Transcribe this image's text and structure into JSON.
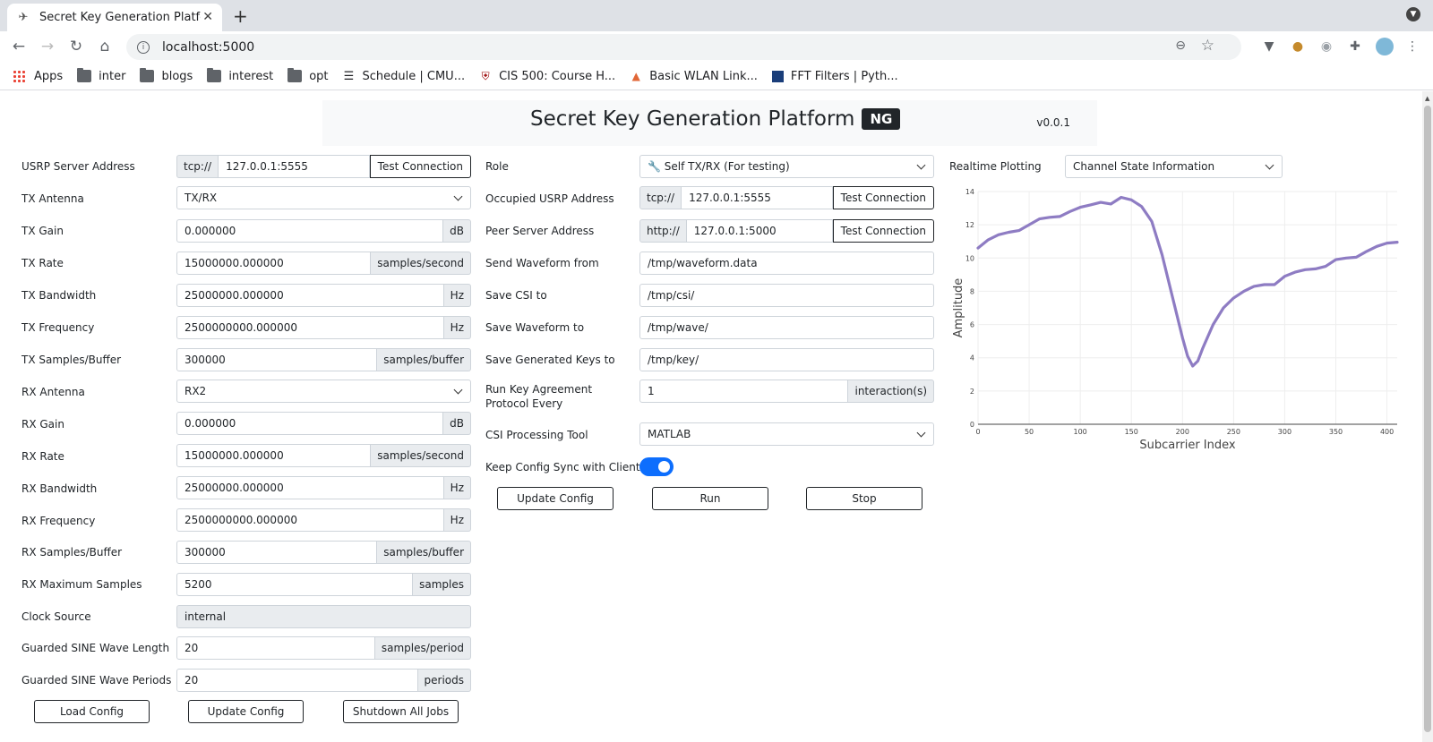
{
  "browser": {
    "tab_title": "Secret Key Generation Platfor",
    "url": "localhost:5000",
    "bookmarks": [
      {
        "label": "Apps",
        "icon": "apps-icon"
      },
      {
        "label": "inter",
        "icon": "folder-icon"
      },
      {
        "label": "blogs",
        "icon": "folder-icon"
      },
      {
        "label": "interest",
        "icon": "folder-icon"
      },
      {
        "label": "opt",
        "icon": "folder-icon"
      },
      {
        "label": "Schedule | CMU...",
        "icon": "database-icon"
      },
      {
        "label": "CIS 500: Course H...",
        "icon": "penn-shield-icon"
      },
      {
        "label": "Basic WLAN Link...",
        "icon": "matlab-icon"
      },
      {
        "label": "FFT Filters | Pyth...",
        "icon": "chart-icon"
      }
    ]
  },
  "header": {
    "title": "Secret Key Generation Platform",
    "badge": "NG",
    "version": "v0.0.1"
  },
  "left": {
    "usrp_label": "USRP Server Address",
    "usrp_prefix": "tcp://",
    "usrp_value": "127.0.0.1:5555",
    "test_connection": "Test Connection",
    "tx_antenna_label": "TX Antenna",
    "tx_antenna_value": "TX/RX",
    "tx_gain_label": "TX Gain",
    "tx_gain_value": "0.000000",
    "tx_gain_unit": "dB",
    "tx_rate_label": "TX Rate",
    "tx_rate_value": "15000000.000000",
    "tx_rate_unit": "samples/second",
    "tx_bw_label": "TX Bandwidth",
    "tx_bw_value": "25000000.000000",
    "tx_bw_unit": "Hz",
    "tx_freq_label": "TX Frequency",
    "tx_freq_value": "2500000000.000000",
    "tx_freq_unit": "Hz",
    "tx_spb_label": "TX Samples/Buffer",
    "tx_spb_value": "300000",
    "tx_spb_unit": "samples/buffer",
    "rx_antenna_label": "RX Antenna",
    "rx_antenna_value": "RX2",
    "rx_gain_label": "RX Gain",
    "rx_gain_value": "0.000000",
    "rx_gain_unit": "dB",
    "rx_rate_label": "RX Rate",
    "rx_rate_value": "15000000.000000",
    "rx_rate_unit": "samples/second",
    "rx_bw_label": "RX Bandwidth",
    "rx_bw_value": "25000000.000000",
    "rx_bw_unit": "Hz",
    "rx_freq_label": "RX Frequency",
    "rx_freq_value": "2500000000.000000",
    "rx_freq_unit": "Hz",
    "rx_spb_label": "RX Samples/Buffer",
    "rx_spb_value": "300000",
    "rx_spb_unit": "samples/buffer",
    "rx_max_label": "RX Maximum Samples",
    "rx_max_value": "5200",
    "rx_max_unit": "samples",
    "clock_label": "Clock Source",
    "clock_value": "internal",
    "sine_len_label": "Guarded SINE Wave Length",
    "sine_len_value": "20",
    "sine_len_unit": "samples/period",
    "sine_per_label": "Guarded SINE Wave Periods",
    "sine_per_value": "20",
    "sine_per_unit": "periods",
    "load_config": "Load Config",
    "update_config": "Update Config",
    "shutdown": "Shutdown All Jobs"
  },
  "middle": {
    "role_label": "Role",
    "role_value": "🔧 Self TX/RX (For testing)",
    "occupied_label": "Occupied USRP Address",
    "occupied_prefix": "tcp://",
    "occupied_value": "127.0.0.1:5555",
    "peer_label": "Peer Server Address",
    "peer_prefix": "http://",
    "peer_value": "127.0.0.1:5000",
    "test_connection": "Test Connection",
    "send_wave_label": "Send Waveform from",
    "send_wave_value": "/tmp/waveform.data",
    "save_csi_label": "Save CSI to",
    "save_csi_value": "/tmp/csi/",
    "save_wave_label": "Save Waveform to",
    "save_wave_value": "/tmp/wave/",
    "save_keys_label": "Save Generated Keys to",
    "save_keys_value": "/tmp/key/",
    "run_every_label": "Run Key Agreement Protocol Every",
    "run_every_value": "1",
    "run_every_unit": "interaction(s)",
    "csi_tool_label": "CSI Processing Tool",
    "csi_tool_value": "MATLAB",
    "sync_label": "Keep Config Sync with Client",
    "sync_on": true,
    "update_config": "Update Config",
    "run": "Run",
    "stop": "Stop"
  },
  "right": {
    "plot_label": "Realtime Plotting",
    "plot_select": "Channel State Information"
  },
  "chart_data": {
    "type": "line",
    "xlabel": "Subcarrier Index",
    "ylabel": "Amplitude",
    "xlim": [
      0,
      410
    ],
    "ylim": [
      0,
      14
    ],
    "x_ticks": [
      0,
      50,
      100,
      150,
      200,
      250,
      300,
      350,
      400
    ],
    "y_ticks": [
      0,
      2,
      4,
      6,
      8,
      10,
      12,
      14
    ],
    "grid": true,
    "color": "#8e7cc3",
    "series": [
      {
        "x": [
          0,
          10,
          20,
          30,
          40,
          50,
          60,
          70,
          80,
          90,
          100,
          110,
          120,
          130,
          140,
          150,
          160,
          170,
          180,
          190,
          200,
          205,
          210,
          215,
          220,
          230,
          240,
          250,
          260,
          270,
          280,
          290,
          300,
          310,
          320,
          330,
          340,
          350,
          360,
          370,
          380,
          390,
          400,
          410
        ],
        "y": [
          10.6,
          11.1,
          11.4,
          11.55,
          11.65,
          12.0,
          12.35,
          12.45,
          12.5,
          12.8,
          13.05,
          13.2,
          13.35,
          13.25,
          13.65,
          13.5,
          13.1,
          12.2,
          10.2,
          7.7,
          5.2,
          4.1,
          3.5,
          3.8,
          4.6,
          6.0,
          7.0,
          7.6,
          8.0,
          8.3,
          8.4,
          8.4,
          8.9,
          9.15,
          9.3,
          9.35,
          9.5,
          9.9,
          10.0,
          10.05,
          10.4,
          10.7,
          10.9,
          10.95
        ]
      }
    ]
  }
}
